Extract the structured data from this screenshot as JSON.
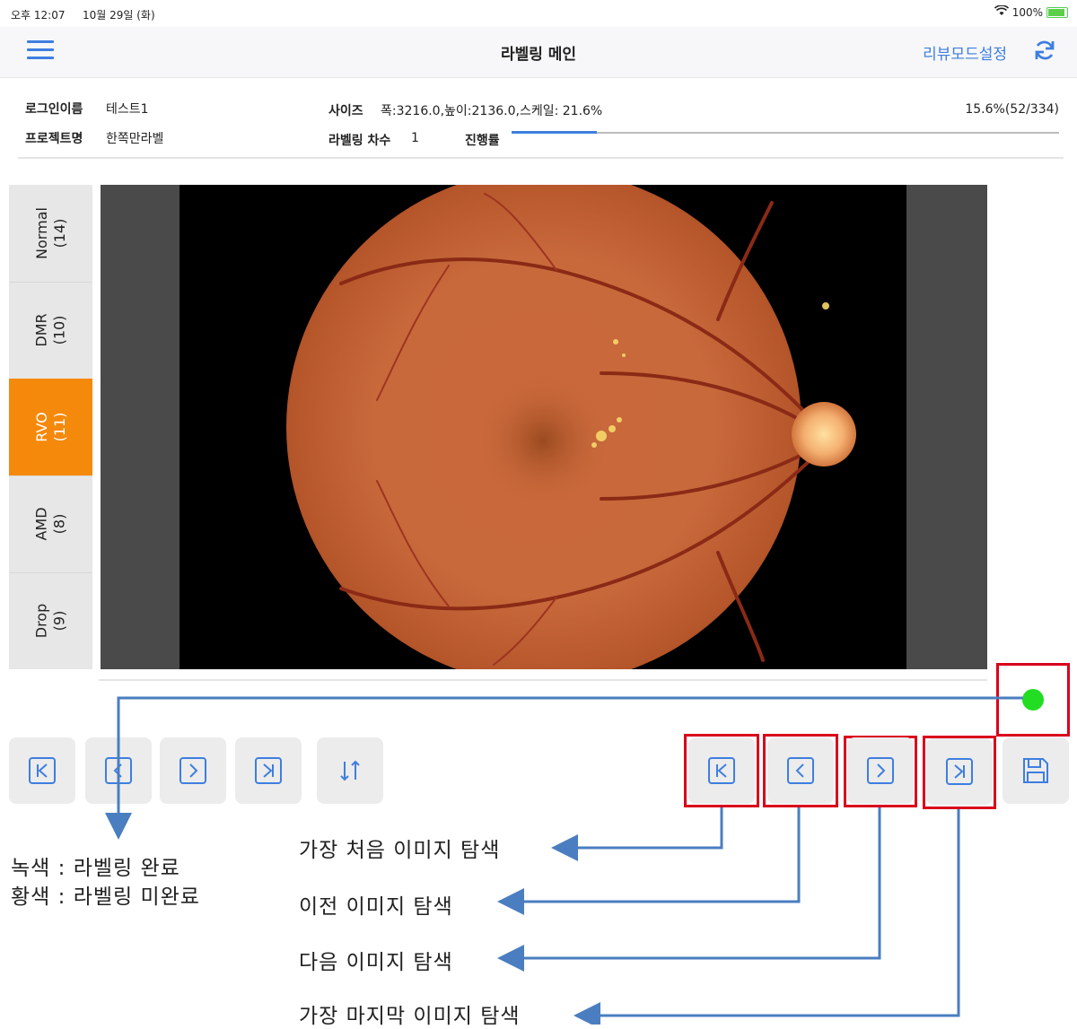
{
  "status_bar": {
    "time": "오후 12:07",
    "date": "10월 29일 (화)",
    "battery": "100%"
  },
  "navbar": {
    "title": "라벨링 메인",
    "review_mode": "리뷰모드설정"
  },
  "info": {
    "login_label": "로그인이름",
    "login_value": "테스트1",
    "project_label": "프로젝트명",
    "project_value": "한쪽만라벨",
    "size_label": "사이즈",
    "size_value": "폭:3216.0,높이:2136.0,스케일: 21.6%",
    "round_label": "라벨링 차수",
    "round_value": "1",
    "progress_label": "진행률",
    "progress_text": "15.6%(52/334)",
    "progress_fraction": 0.156
  },
  "tabs": [
    {
      "name": "Normal",
      "count": "(14)"
    },
    {
      "name": "DMR",
      "count": "(10)"
    },
    {
      "name": "RVO",
      "count": "(11)",
      "active": true
    },
    {
      "name": "AMD",
      "count": "(8)"
    },
    {
      "name": "Drop",
      "count": "(9)"
    }
  ],
  "annotations": {
    "legend_green": "녹색 : 라벨링 완료",
    "legend_yellow": "황색 : 라벨링 미완료",
    "first": "가장 처음 이미지 탐색",
    "prev": "이전 이미지 탐색",
    "next": "다음 이미지 탐색",
    "last": "가장 마지막 이미지 탐색"
  },
  "colors": {
    "accent": "#3e7ee0",
    "active_tab": "#f5890c",
    "highlight": "#d9001b",
    "labeled_dot": "#22dd22"
  }
}
